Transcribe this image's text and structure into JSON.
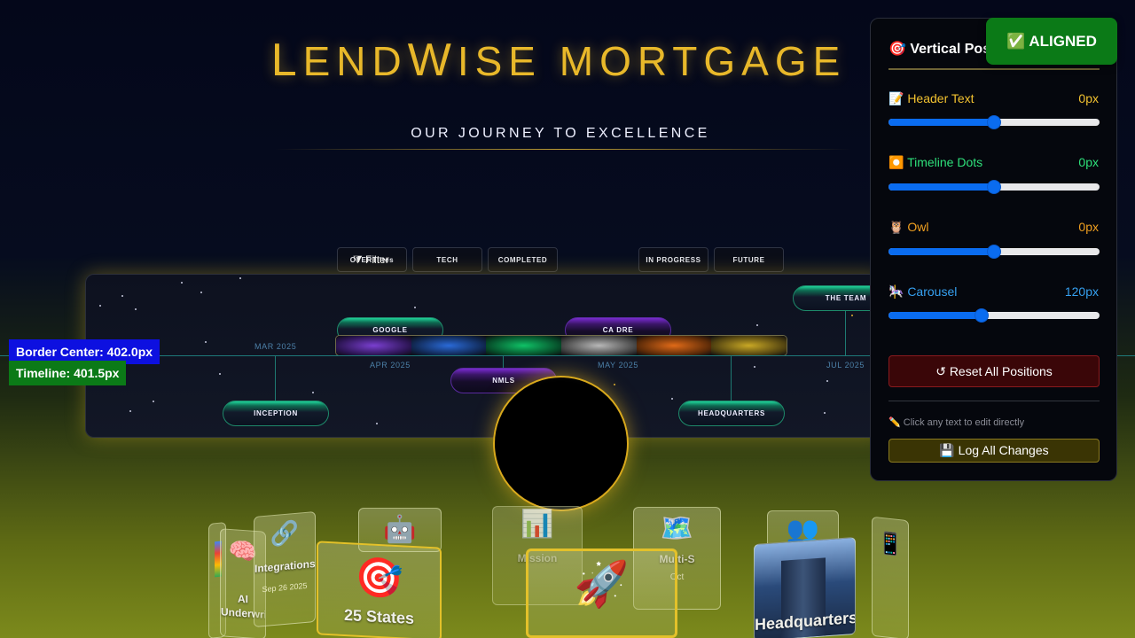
{
  "header": {
    "brand_l": "L",
    "brand_end": "END",
    "brand_w": "W",
    "brand_ise": "ISE",
    "brand_mortgage": "MORTGAGE",
    "subtitle": "OUR JOURNEY TO EXCELLENCE"
  },
  "filters": {
    "overlap": "OVERTiltes",
    "filter_label": "⧩ Filter",
    "chips": [
      "TECH",
      "COMPLETED",
      "IN PROGRESS",
      "FUTURE"
    ]
  },
  "timeline": {
    "months": [
      "MAR 2025",
      "APR 2025",
      "MAY 2025",
      "JUL 2025"
    ],
    "milestones": {
      "inception": "INCEPTION",
      "google": "GOOGLE",
      "nmls": "NMLS",
      "ca_dre": "CA DRE",
      "headquarters": "HEADQUARTERS",
      "the_team": "THE TEAM"
    },
    "strip_colors": [
      "#7a3fd0",
      "#2a6ad8",
      "#0fc266",
      "#b8b8b8",
      "#e06a18",
      "#c9a825"
    ]
  },
  "debug": {
    "border_center": "Border Center: 402.0px",
    "timeline": "Timeline: 401.5px"
  },
  "carousel": {
    "cards": {
      "ai": {
        "emoji": "🧠",
        "title": "AI Underwriting"
      },
      "integrations": {
        "emoji": "🔗",
        "title": "Integrations",
        "sub": "Sep 26 2025"
      },
      "robot": {
        "emoji": "🤖"
      },
      "states": {
        "emoji": "🎯",
        "title": "25 States"
      },
      "mission": {
        "emoji": "📊",
        "title": "Mission"
      },
      "rocket": {
        "emoji": "🚀"
      },
      "multi": {
        "emoji": "🗺️",
        "title": "Multi-S",
        "sub": "Oct"
      },
      "team": {
        "emoji": "👥"
      },
      "hq": {
        "title": "Headquarters"
      },
      "edge": {
        "emoji": "📱"
      }
    }
  },
  "control": {
    "title": "🎯 Vertical Pos",
    "aligned": "✅ ALIGNED",
    "rows": [
      {
        "label": "📝 Header Text",
        "value": "0px",
        "color": "#f2c230",
        "level": 0.5
      },
      {
        "label": "⏺️ Timeline Dots",
        "value": "0px",
        "color": "#2ee07a",
        "level": 0.5
      },
      {
        "label": "🦉 Owl",
        "value": "0px",
        "color": "#f0a020",
        "level": 0.5
      },
      {
        "label": "🎠 Carousel",
        "value": "120px",
        "color": "#36a0f0",
        "level": 0.44
      }
    ],
    "reset": "↺ Reset All Positions",
    "hint": "✏️ Click any text to edit directly",
    "log": "💾 Log All Changes"
  }
}
